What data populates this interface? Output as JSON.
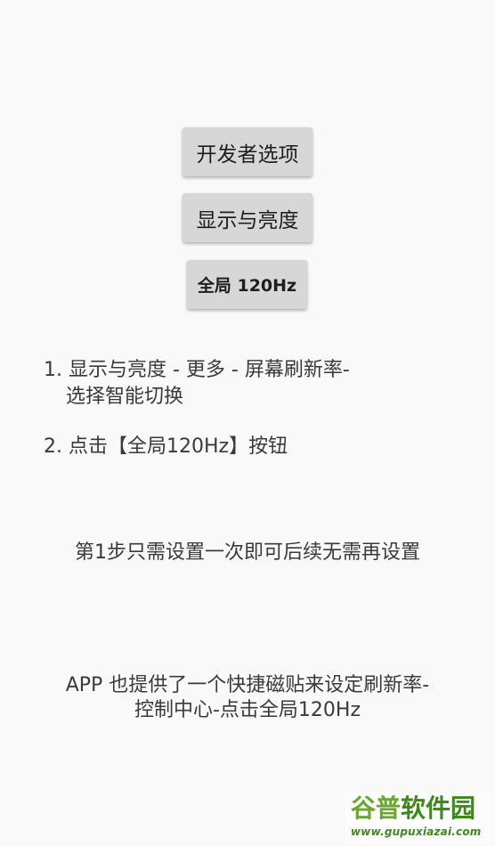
{
  "buttons": {
    "developer_options": "开发者选项",
    "display_brightness": "显示与亮度",
    "global_120hz": "全局 120Hz"
  },
  "instructions": {
    "step1_line1": "1. 显示与亮度 - 更多 - 屏幕刷新率-",
    "step1_line2": "选择智能切换",
    "step2": "2. 点击【全局120Hz】按钮"
  },
  "note": "第1步只需设置一次即可后续无需再设置",
  "quick_tile_info": {
    "line1": "APP 也提供了一个快捷磁贴来设定刷新率-",
    "line2": "控制中心-点击全局120Hz"
  },
  "watermark": {
    "title_part1": "谷普",
    "title_part2": "软件园",
    "url": "www.gupuxiazai.com"
  },
  "colors": {
    "background": "#f9f9f9",
    "button_background": "#d7d7d7",
    "text": "#3a3a3a",
    "watermark_green": "#3c8a1a"
  }
}
